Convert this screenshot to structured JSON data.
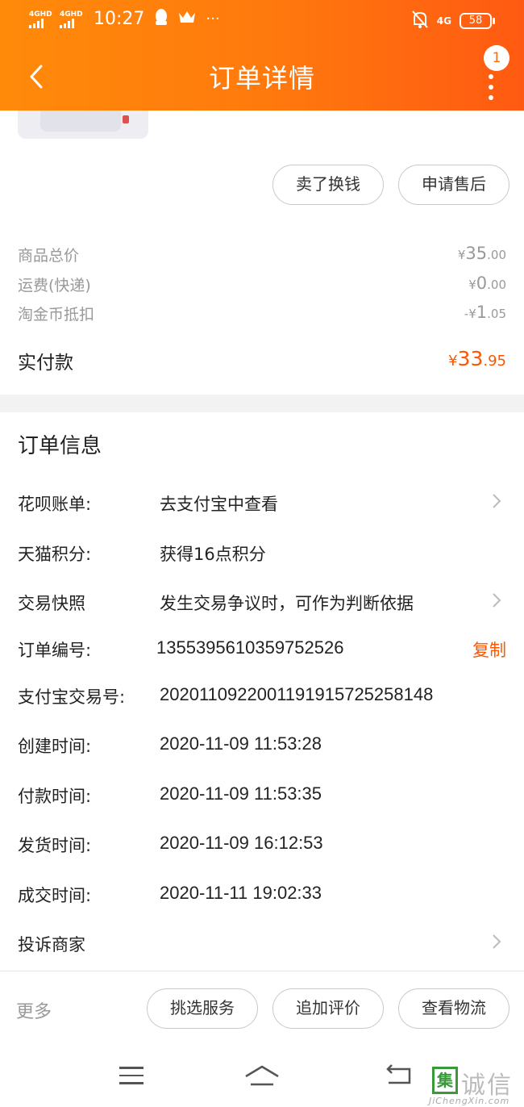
{
  "status_bar": {
    "signal_1": "4GHD",
    "signal_2": "4GHD",
    "time": "10:27",
    "extra": "···",
    "network": "4G",
    "battery": "58"
  },
  "header": {
    "title": "订单详情",
    "badge_count": "1"
  },
  "actions_top": {
    "sell_label": "卖了换钱",
    "after_sale_label": "申请售后"
  },
  "price": {
    "goods_total_label": "商品总价",
    "goods_total": {
      "cur": "¥",
      "int": "35",
      "dec": ".00"
    },
    "shipping_label": "运费(快递)",
    "shipping": {
      "cur": "¥",
      "int": "0",
      "dec": ".00"
    },
    "coin_label": "淘金币抵扣",
    "coin": {
      "cur": "-¥",
      "int": "1",
      "dec": ".05"
    },
    "paid_label": "实付款",
    "paid": {
      "cur": "¥",
      "int": "33",
      "dec": ".95"
    }
  },
  "order_info": {
    "title": "订单信息",
    "rows": [
      {
        "key": "花呗账单:",
        "value": "去支付宝中查看"
      },
      {
        "key": "天猫积分:",
        "value": "获得16点积分"
      },
      {
        "key": "交易快照",
        "value": "发生交易争议时，可作为判断依据"
      },
      {
        "key": "订单编号:",
        "value": "1355395610359752526",
        "action": "复制"
      },
      {
        "key": "支付宝交易号:",
        "value": "2020110922001191915725258148"
      },
      {
        "key": "创建时间:",
        "value": "2020-11-09 11:53:28"
      },
      {
        "key": "付款时间:",
        "value": "2020-11-09 11:53:35"
      },
      {
        "key": "发货时间:",
        "value": "2020-11-09 16:12:53"
      },
      {
        "key": "成交时间:",
        "value": "2020-11-11 19:02:33"
      },
      {
        "key": "投诉商家",
        "value": ""
      }
    ]
  },
  "bottom_bar": {
    "more_label": "更多",
    "select_service_label": "挑选服务",
    "add_review_label": "追加评价",
    "logistics_label": "查看物流"
  },
  "watermark": {
    "box_char": "集",
    "text": "诚信",
    "url": "JiChengXin.com"
  },
  "colors": {
    "header_start": "#ff8a0a",
    "header_end": "#ff5a12",
    "accent": "#ff5500"
  }
}
